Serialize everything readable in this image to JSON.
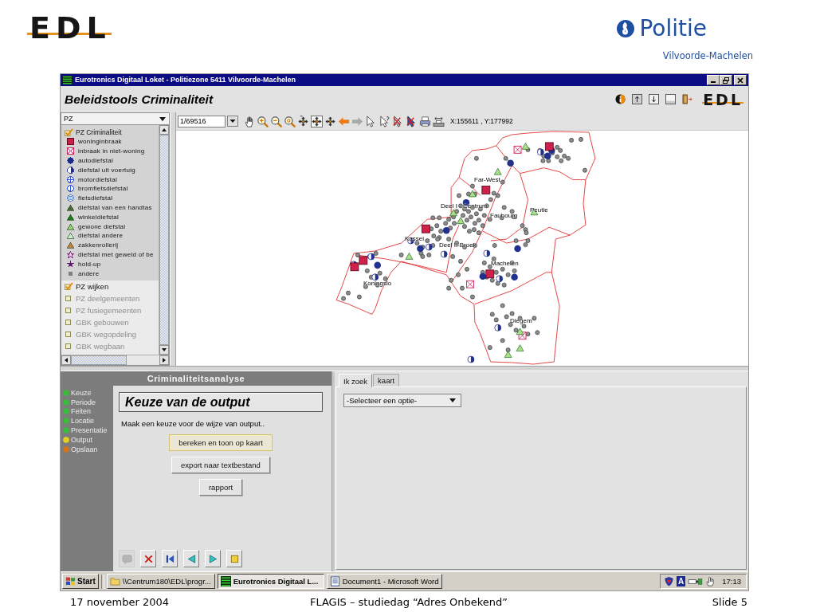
{
  "slide_header": {
    "logo": "EDL",
    "brand": "Politie",
    "subtitle": "Vilvoorde-Machelen"
  },
  "window": {
    "title": "Eurotronics Digitaal Loket - Politiezone 5411 Vilvoorde-Machelen",
    "heading": "Beleidstools Criminaliteit",
    "logo": "EDL"
  },
  "layer_panel": {
    "dropdown": "PZ",
    "layers": [
      {
        "label": "PZ Criminaliteit",
        "checked": true,
        "children": [
          {
            "label": "woninginbraak",
            "kind": "square",
            "color": "#c8204a"
          },
          {
            "label": "inbraak in niet-woning",
            "kind": "crossbox",
            "color": "#d0205a"
          },
          {
            "label": "autodiefstal",
            "kind": "dot",
            "color": "#1c2a8c"
          },
          {
            "label": "diefstal uit voertuig",
            "kind": "halfdot",
            "color": "#1c2a8c"
          },
          {
            "label": "motordiefstal",
            "kind": "crosscircle",
            "color": "#3050e0"
          },
          {
            "label": "bromfietsdiefstal",
            "kind": "phicircle",
            "color": "#3050e0"
          },
          {
            "label": "fietsdiefstal",
            "kind": "ring",
            "color": "#5080e0"
          },
          {
            "label": "diefstal van een handtas",
            "kind": "triangle",
            "color": "#4a6a3a"
          },
          {
            "label": "winkeldiefstal",
            "kind": "triangle",
            "color": "#1f7a1f"
          },
          {
            "label": "gewone diefstal",
            "kind": "triangle",
            "color": "#90d070"
          },
          {
            "label": "diefstal andere",
            "kind": "triangle",
            "color": "#c8f0c8"
          },
          {
            "label": "zakkenrollerij",
            "kind": "triangle",
            "color": "#c08040"
          },
          {
            "label": "diefstal met geweld of be",
            "kind": "staroutline",
            "color": "#8a3a8a"
          },
          {
            "label": "hold-up",
            "kind": "star",
            "color": "#5a1a6a"
          },
          {
            "label": "andere",
            "kind": "smalldot",
            "color": "#808080"
          }
        ]
      },
      {
        "label": "PZ wijken",
        "checked": true
      },
      {
        "label": "PZ deelgemeenten",
        "checked": false
      },
      {
        "label": "PZ fusiegemeenten",
        "checked": false
      },
      {
        "label": "GBK gebouwen",
        "checked": false
      },
      {
        "label": "GBK wegopdeling",
        "checked": false
      },
      {
        "label": "GBK wegbaan",
        "checked": false
      }
    ]
  },
  "map_toolbar": {
    "scale": "1/69516",
    "tools": [
      {
        "kind": "hand",
        "selected": false
      },
      {
        "kind": "zoomin",
        "selected": false
      },
      {
        "kind": "zoomout",
        "selected": false
      },
      {
        "kind": "zoomscale",
        "selected": false
      },
      {
        "kind": "panup",
        "selected": false
      },
      {
        "kind": "pan",
        "selected": true
      },
      {
        "kind": "pancenter",
        "selected": false
      },
      {
        "kind": "back",
        "selected": false
      },
      {
        "kind": "forward",
        "selected": false
      },
      {
        "kind": "select",
        "selected": false
      },
      {
        "kind": "query",
        "selected": false
      },
      {
        "kind": "deselect",
        "selected": false
      },
      {
        "kind": "deselectall",
        "selected": false
      },
      {
        "kind": "print",
        "selected": false
      },
      {
        "kind": "export",
        "selected": false
      }
    ],
    "coordinates": "X:155611 , Y:177992"
  },
  "map": {
    "labels": [
      "Far-West",
      "Deel I - Centrum",
      "Faubourg",
      "Peutie",
      "Kassei",
      "Deel II-Broek",
      "Koningslo",
      "Machelen",
      "Diegem"
    ]
  },
  "analysis": {
    "title": "Criminaliteitsanalyse",
    "steps": [
      {
        "label": "Keuze",
        "color": "#3cba3c"
      },
      {
        "label": "Periode",
        "color": "#3cba3c"
      },
      {
        "label": "Feiten",
        "color": "#3cba3c"
      },
      {
        "label": "Locatie",
        "color": "#3cba3c"
      },
      {
        "label": "Presentatie",
        "color": "#3cba3c"
      },
      {
        "label": "Output",
        "color": "#e6d21e"
      },
      {
        "label": "Opslaan",
        "color": "#d2741a"
      }
    ],
    "heading": "Keuze van de output",
    "instruction": "Maak een keuze voor de wijze van output..",
    "buttons": [
      {
        "label": "bereken en toon op kaart",
        "focused": true
      },
      {
        "label": "export naar textbestand",
        "focused": false
      },
      {
        "label": "rapport",
        "focused": false
      }
    ],
    "nav_buttons": [
      {
        "kind": "help",
        "disabled": true
      },
      {
        "kind": "cancel",
        "disabled": false
      },
      {
        "kind": "first",
        "disabled": false
      },
      {
        "kind": "previous",
        "disabled": false
      },
      {
        "kind": "next",
        "disabled": false
      },
      {
        "kind": "stop",
        "disabled": false
      }
    ]
  },
  "search_panel": {
    "tabs": [
      {
        "label": "Ik zoek",
        "selected": true
      },
      {
        "label": "kaart",
        "selected": false
      }
    ],
    "dropdown": "-Selecteer een optie-"
  },
  "taskbar": {
    "start": "Start",
    "tasks": [
      {
        "kind": "folder",
        "label": "\\\\Centrum180\\EDL\\progr...",
        "selected": false
      },
      {
        "kind": "app",
        "label": "Eurotronics Digitaal L...",
        "selected": true
      },
      {
        "kind": "word",
        "label": "Document1 - Microsoft Word",
        "selected": false
      }
    ],
    "tray_badge": "A",
    "clock": "17:13"
  },
  "footer": {
    "date": "17 november 2004",
    "title": "FLAGIS – studiedag “Adres Onbekend”",
    "slide": "Slide 5"
  }
}
